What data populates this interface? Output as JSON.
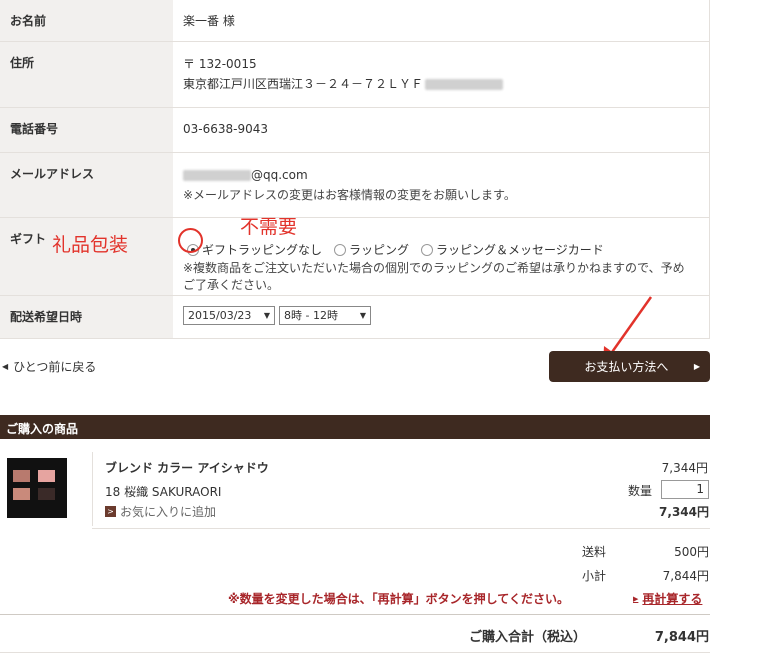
{
  "form": {
    "name_label": "お名前",
    "name_value": "楽一番 様",
    "address_label": "住所",
    "postal": "〒 132-0015",
    "address_line": "東京都江戸川区西瑞江３－２４－７２ＬＹＦ",
    "tel_label": "電話番号",
    "tel_value": "03-6638-9043",
    "mail_label": "メールアドレス",
    "mail_domain": "@qq.com",
    "mail_note": "※メールアドレスの変更はお客様情報の変更をお願いします。",
    "gift_label": "ギフト",
    "gift_options": [
      {
        "label": "ギフトラッピングなし",
        "checked": true
      },
      {
        "label": "ラッピング",
        "checked": false
      },
      {
        "label": "ラッピング＆メッセージカード",
        "checked": false
      }
    ],
    "gift_note_1": "※複数商品をご注文いただいた場合の個別でのラッピングのご希望は承りかねますので、予め",
    "gift_note_2": "ご了承ください。",
    "delivery_label": "配送希望日時",
    "delivery_date": "2015/03/23",
    "delivery_time": "8時 - 12時"
  },
  "annotations": {
    "gift_cn": "礼品包装",
    "no_need_cn": "不需要"
  },
  "nav": {
    "back_label": "ひとつ前に戻る",
    "pay_button": "お支払い方法へ"
  },
  "cart": {
    "section_title": "ご購入の商品",
    "product_name": "ブレンド カラー アイシャドウ",
    "product_variant": "18 桜織 SAKURAORI",
    "favorite_label": "お気に入りに追加",
    "unit_price": "7,344円",
    "qty_label": "数量",
    "qty_value": "1",
    "line_total": "7,344円",
    "shipping_label": "送料",
    "shipping_value": "500円",
    "subtotal_label": "小計",
    "subtotal_value": "7,844円",
    "warning": "※数量を変更した場合は、「再計算」ボタンを押してください。",
    "recalc_label": "再計算する",
    "total_label": "ご購入合計（税込）",
    "total_value": "7,844円"
  },
  "colors": {
    "dark_brown": "#3e2a20",
    "accent_red": "#a8262a",
    "annotation_red": "#e2332b",
    "label_bg": "#f2f0ee"
  }
}
